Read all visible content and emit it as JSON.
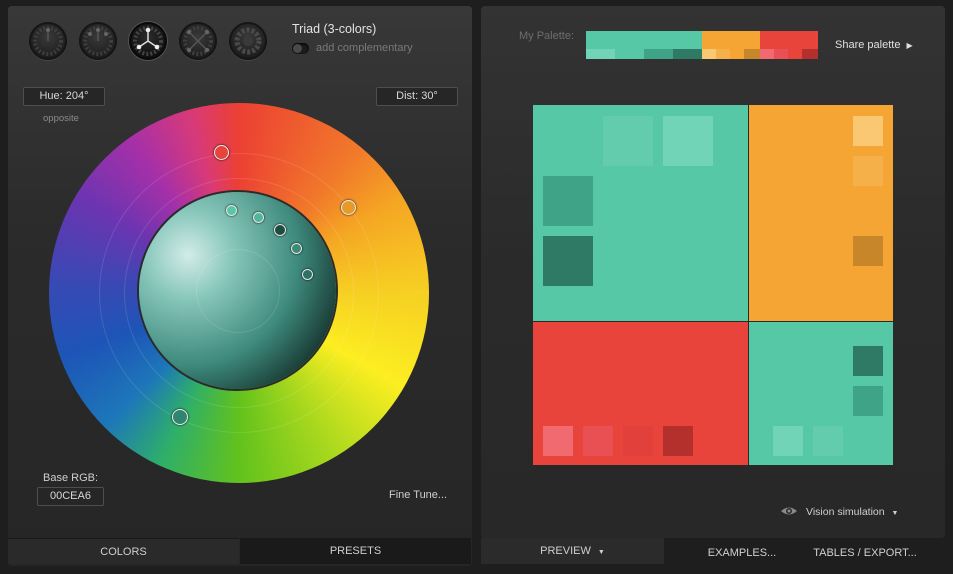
{
  "rules": [
    {
      "name": "analogous"
    },
    {
      "name": "monochromatic"
    },
    {
      "name": "triad",
      "active": true
    },
    {
      "name": "complementary"
    },
    {
      "name": "compound"
    }
  ],
  "rule_title": "Triad (3-colors)",
  "complementary_label": "add complementary",
  "hue_label": "Hue: 204°",
  "hue_sub": "opposite",
  "dist_label": "Dist: 30°",
  "base_rgb_label": "Base RGB:",
  "base_rgb_value": "00CEA6",
  "fine_tune": "Fine Tune...",
  "my_palette_label": "My Palette:",
  "share_palette": "Share palette",
  "vision_simulation": "Vision simulation",
  "tabs": {
    "colors": "COLORS",
    "presets": "PRESETS",
    "preview": "PREVIEW",
    "examples": "EXAMPLES...",
    "tables": "TABLES / EXPORT..."
  },
  "colors": {
    "teal": "#57c8a6",
    "orange": "#f4a534",
    "red": "#e8443b",
    "teal_light": "#72d4b7",
    "teal_mid": "#3fa387",
    "teal_dark": "#2e7a64",
    "orange_light": "#fac772",
    "orange_mid": "#f5b04a",
    "orange_dark": "#c7862a",
    "red_light": "#f06a70",
    "red_mid": "#e85054",
    "red_dark": "#b3302c"
  }
}
